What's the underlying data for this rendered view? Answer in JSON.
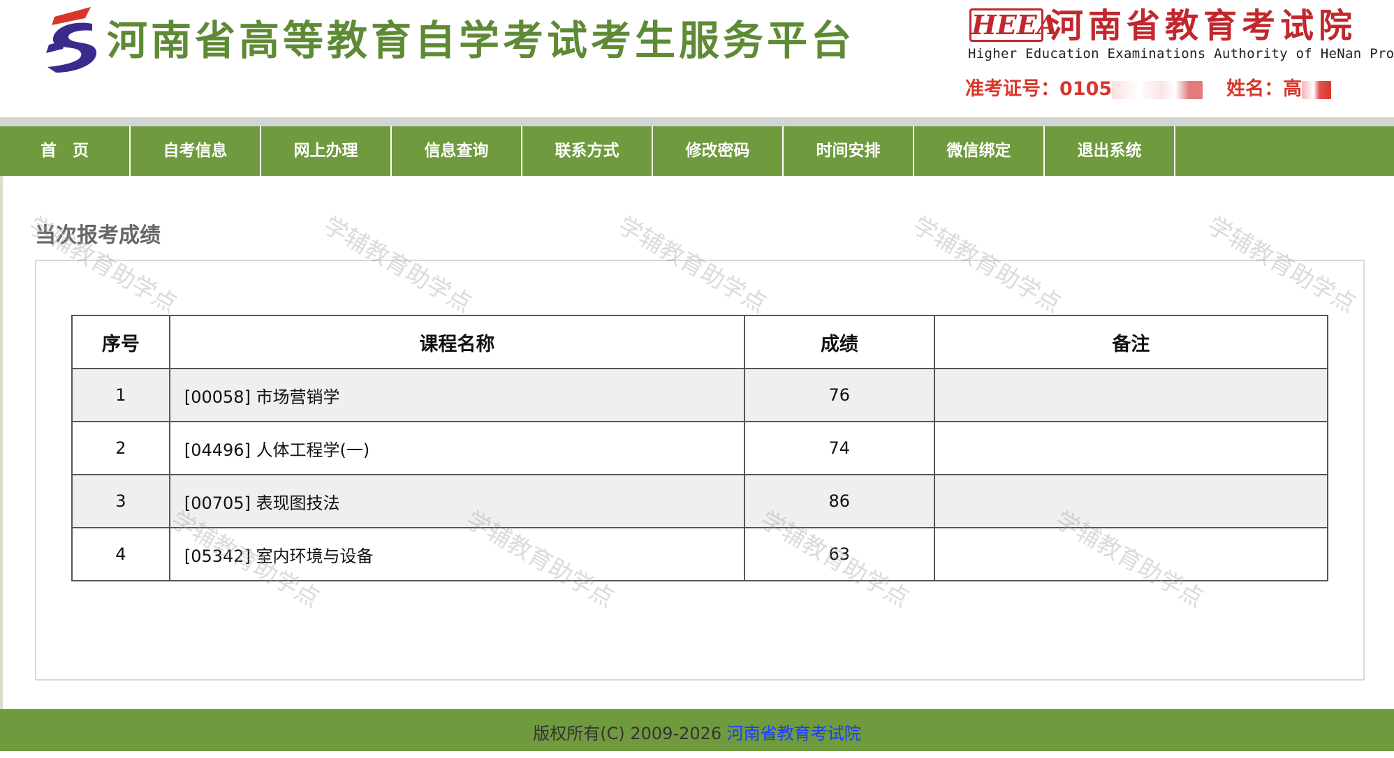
{
  "header": {
    "site_title": "河南省高等教育自学考试考生服务平台",
    "logo_text": "HEEA",
    "authority_cn": "河南省教育考试院",
    "authority_en": "Higher Education Examinations Authority of HeNan Province",
    "ticket_label": "准考证号：",
    "ticket_value": "0105",
    "name_label": "姓名：",
    "name_value": "高"
  },
  "nav": {
    "items": [
      "首　页",
      "自考信息",
      "网上办理",
      "信息查询",
      "联系方式",
      "修改密码",
      "时间安排",
      "微信绑定",
      "退出系统"
    ]
  },
  "section": {
    "title": "当次报考成绩"
  },
  "table": {
    "headers": [
      "序号",
      "课程名称",
      "成绩",
      "备注"
    ],
    "rows": [
      {
        "no": "1",
        "course": "[00058] 市场营销学",
        "score": "76",
        "note": ""
      },
      {
        "no": "2",
        "course": "[04496] 人体工程学(一)",
        "score": "74",
        "note": ""
      },
      {
        "no": "3",
        "course": "[00705] 表现图技法",
        "score": "86",
        "note": ""
      },
      {
        "no": "4",
        "course": "[05342] 室内环境与设备",
        "score": "63",
        "note": ""
      }
    ]
  },
  "watermark": "学辅教育助学点",
  "footer": {
    "copyright": "版权所有(C) 2009-2026 ",
    "link_text": "河南省教育考试院"
  },
  "colors": {
    "nav_green": "#6f9a3e",
    "title_green": "#5e8a35",
    "brand_red": "#c0282e"
  }
}
